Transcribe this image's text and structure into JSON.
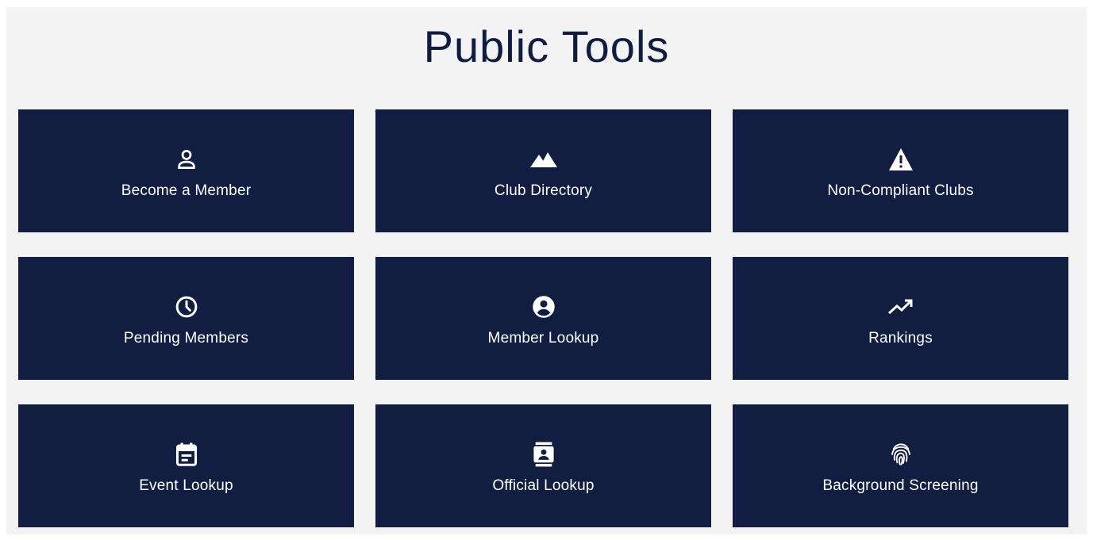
{
  "page": {
    "title": "Public Tools",
    "colors": {
      "panel_background": "#f3f3f3",
      "tile_background": "#111e42",
      "title_text": "#111c41",
      "tile_text": "#ffffff"
    }
  },
  "tiles": [
    {
      "label": "Become a Member",
      "icon": "person-outline-icon"
    },
    {
      "label": "Club Directory",
      "icon": "mountains-icon"
    },
    {
      "label": "Non-Compliant Clubs",
      "icon": "warning-triangle-icon"
    },
    {
      "label": "Pending Members",
      "icon": "clock-icon"
    },
    {
      "label": "Member Lookup",
      "icon": "account-circle-icon"
    },
    {
      "label": "Rankings",
      "icon": "trending-up-icon"
    },
    {
      "label": "Event Lookup",
      "icon": "calendar-icon"
    },
    {
      "label": "Official Lookup",
      "icon": "id-badge-icon"
    },
    {
      "label": "Background Screening",
      "icon": "fingerprint-icon"
    }
  ]
}
